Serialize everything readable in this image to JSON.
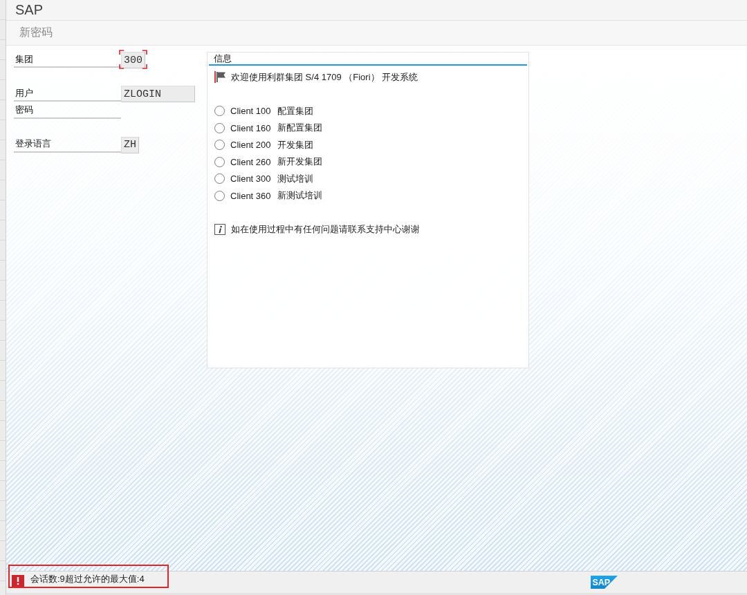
{
  "app_title": "SAP",
  "screen_title": "新密码",
  "form": {
    "groups": [
      [
        {
          "label": "集团",
          "value": "300",
          "focused": true
        }
      ],
      [
        {
          "label": "用户",
          "value": "ZLOGIN",
          "focused": false
        },
        {
          "label": "密码"
        }
      ],
      [
        {
          "label": "登录语言",
          "value": "ZH",
          "focused": false
        }
      ]
    ]
  },
  "info_panel": {
    "title": "信息",
    "header": {
      "kind": "flag",
      "text": "欢迎使用利群集团 S/4 1709 （Fiori） 开发系统"
    },
    "options": [
      {
        "client": "Client 100",
        "name": "配置集团",
        "selected": false
      },
      {
        "client": "Client 160",
        "name": "新配置集团",
        "selected": false
      },
      {
        "client": "Client 200",
        "name": "开发集团",
        "selected": false
      },
      {
        "client": "Client 260",
        "name": "新开发集团",
        "selected": false
      },
      {
        "client": "Client 300",
        "name": "测试培训",
        "selected": false
      },
      {
        "client": "Client 360",
        "name": "新测试培训",
        "selected": false
      }
    ],
    "footer": {
      "kind": "info",
      "text": "如在使用过程中有任何问题请联系支持中心谢谢"
    }
  },
  "status_bar": {
    "message": {
      "kind": "error",
      "text": "会话数:9超过允许的最大值:4",
      "highlighted": true
    },
    "logo": "SAP"
  }
}
